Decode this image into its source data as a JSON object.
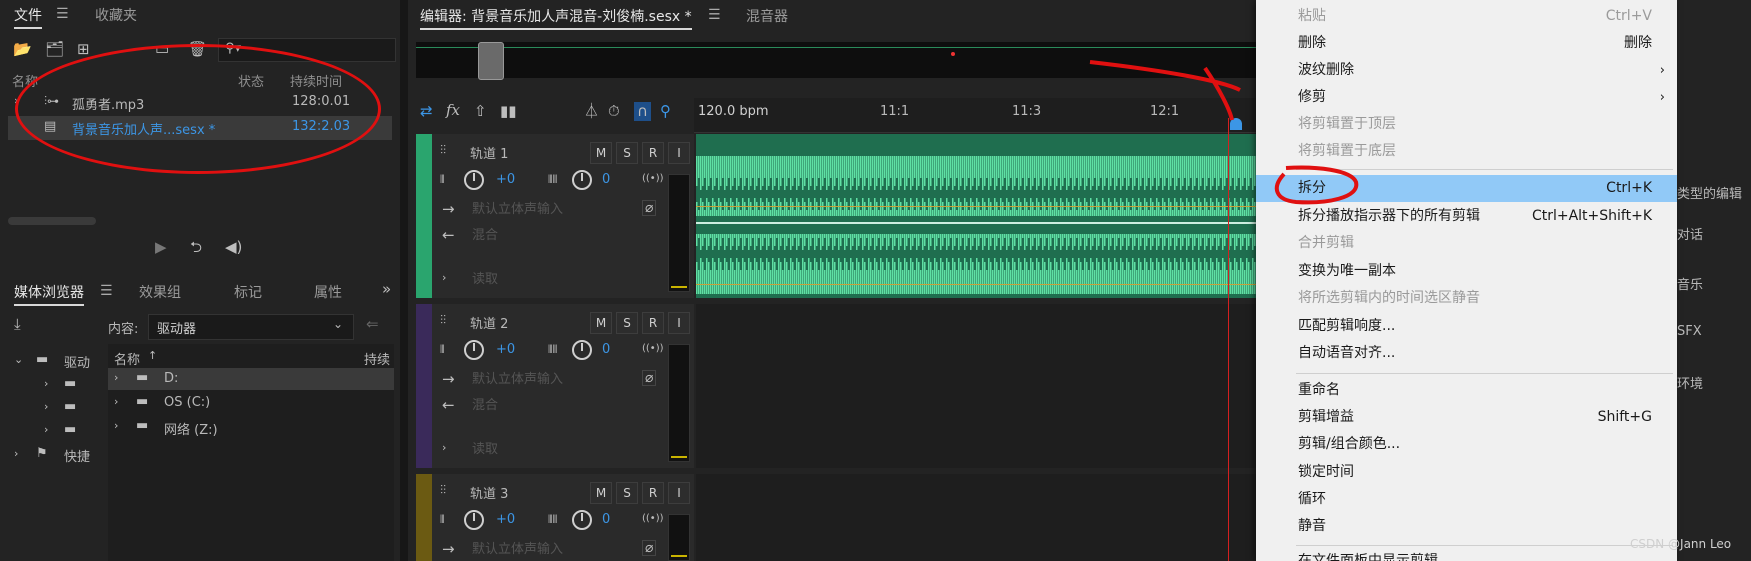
{
  "files_panel": {
    "tab_files": "文件",
    "tab_favorites": "收藏夹",
    "col_name": "名称",
    "col_status": "状态",
    "col_duration": "持续时间",
    "items": [
      {
        "name": "孤勇者.mp3",
        "duration": "128:0.01"
      },
      {
        "name": "背景音乐加人声...sesx *",
        "duration": "132:2.03"
      }
    ]
  },
  "media_panel": {
    "tab_media": "媒体浏览器",
    "tab_effects": "效果组",
    "tab_markers": "标记",
    "tab_properties": "属性",
    "content_label": "内容:",
    "content_value": "驱动器",
    "col_name": "名称",
    "col_duration": "持续",
    "tree": [
      "驱动",
      "快捷"
    ],
    "drives": [
      "D:",
      "OS (C:)",
      "网络 (Z:)"
    ]
  },
  "editor": {
    "tab_editor": "编辑器: 背景音乐加人声混音-刘俊楠.sesx *",
    "tab_mixer": "混音器",
    "bpm": "120.0 bpm",
    "ruler": [
      "11:1",
      "11:3",
      "12:1"
    ],
    "tracks": [
      {
        "name": "轨道 1",
        "vol": "+0",
        "pan": "0",
        "input": "默认立体声输入",
        "output": "混合",
        "read": "读取",
        "color": "#2aa56e"
      },
      {
        "name": "轨道 2",
        "vol": "+0",
        "pan": "0",
        "input": "默认立体声输入",
        "output": "混合",
        "read": "读取",
        "color": "#3a2a5a"
      },
      {
        "name": "轨道 3",
        "vol": "+0",
        "pan": "0",
        "input": "默认立体声输入",
        "output": "",
        "read": "",
        "color": "#6b5a12"
      }
    ],
    "btn_m": "M",
    "btn_s": "S",
    "btn_r": "R",
    "btn_i": "I"
  },
  "context_menu": {
    "items": [
      {
        "label": "粘贴",
        "shortcut": "Ctrl+V",
        "disabled": true
      },
      {
        "label": "删除",
        "shortcut": "删除"
      },
      {
        "label": "波纹删除",
        "submenu": true
      },
      {
        "label": "修剪",
        "submenu": true
      },
      {
        "label": "将剪辑置于顶层",
        "disabled": true
      },
      {
        "label": "将剪辑置于底层",
        "disabled": true
      },
      {
        "label": "拆分",
        "shortcut": "Ctrl+K",
        "highlight": true
      },
      {
        "label": "拆分播放指示器下的所有剪辑",
        "shortcut": "Ctrl+Alt+Shift+K"
      },
      {
        "label": "合并剪辑",
        "disabled": true
      },
      {
        "label": "变换为唯一副本"
      },
      {
        "label": "将所选剪辑内的时间选区静音",
        "disabled": true
      },
      {
        "label": "匹配剪辑响度..."
      },
      {
        "label": "自动语音对齐..."
      },
      {
        "label": "重命名"
      },
      {
        "label": "剪辑增益",
        "shortcut": "Shift+G"
      },
      {
        "label": "剪辑/组合颜色..."
      },
      {
        "label": "锁定时间"
      },
      {
        "label": "循环"
      },
      {
        "label": "静音"
      },
      {
        "label": "在文件面板中显示剪辑"
      }
    ]
  },
  "right_panel": {
    "items": [
      "类型的编辑",
      "对话",
      "音乐",
      "SFX",
      "环境"
    ]
  },
  "watermark": "CSDN @Jann Leo"
}
